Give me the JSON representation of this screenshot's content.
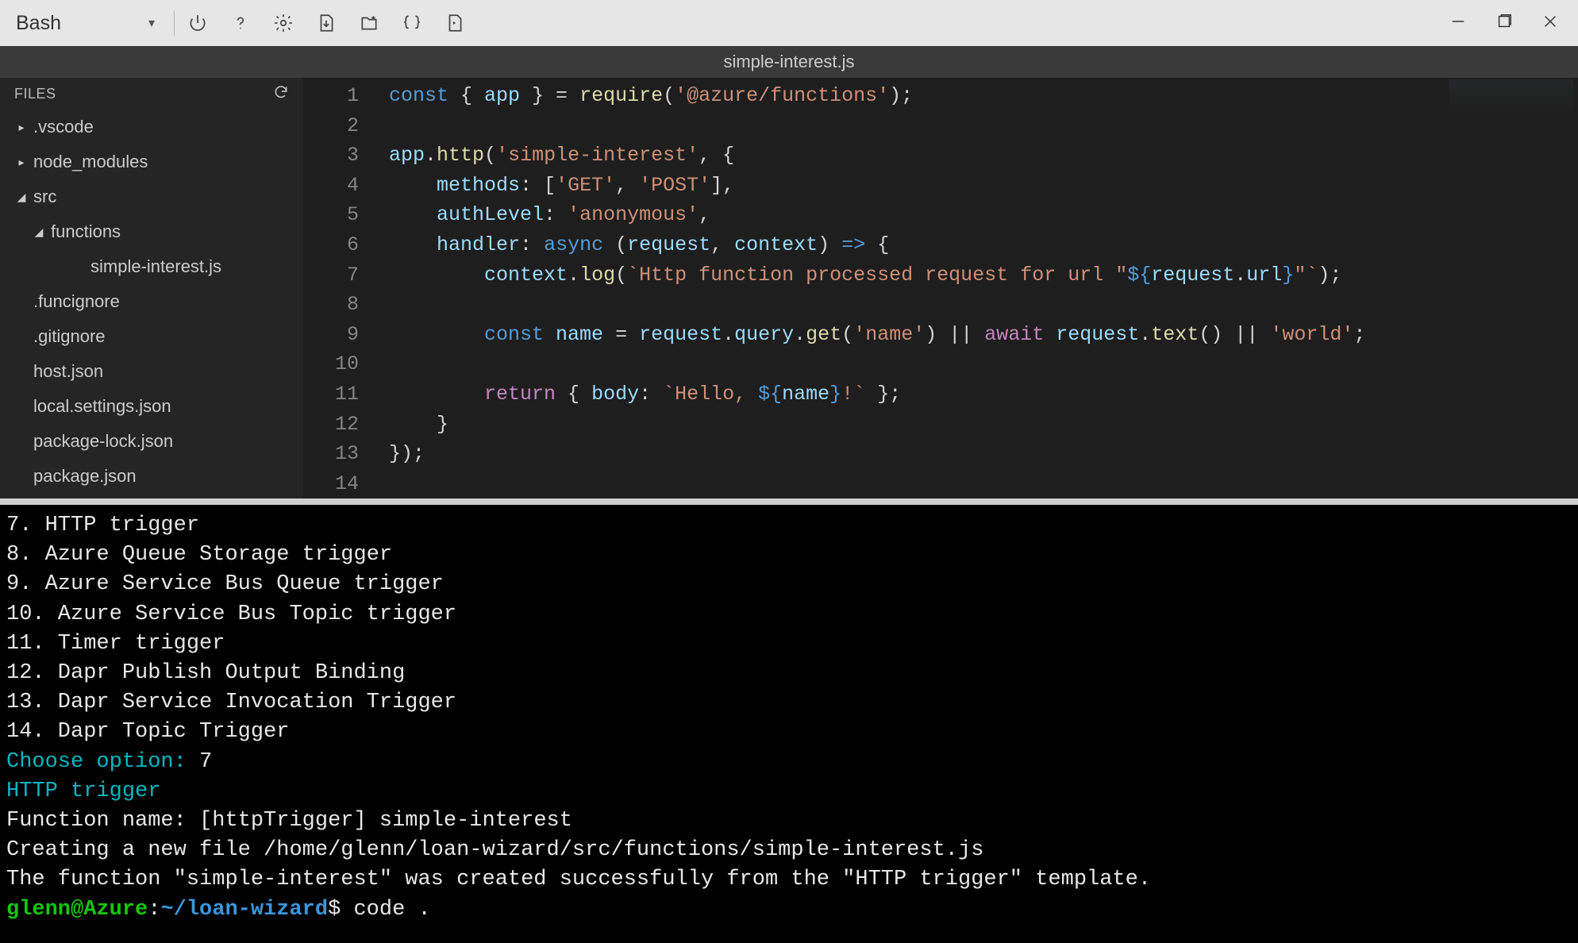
{
  "toolbar": {
    "shell_label": "Bash",
    "icons": [
      "power-icon",
      "help-icon",
      "settings-icon",
      "download-icon",
      "upload-icon",
      "braces-icon",
      "preview-icon"
    ]
  },
  "tab": {
    "filename": "simple-interest.js"
  },
  "sidebar": {
    "header": "FILES",
    "items": [
      {
        "label": ".vscode",
        "twisty": "▸",
        "indent": 0
      },
      {
        "label": "node_modules",
        "twisty": "▸",
        "indent": 0
      },
      {
        "label": "src",
        "twisty": "◢",
        "indent": 0
      },
      {
        "label": "functions",
        "twisty": "◢",
        "indent": 1
      },
      {
        "label": "simple-interest.js",
        "twisty": "",
        "indent": 3
      },
      {
        "label": ".funcignore",
        "twisty": "",
        "indent": 0
      },
      {
        "label": ".gitignore",
        "twisty": "",
        "indent": 0
      },
      {
        "label": "host.json",
        "twisty": "",
        "indent": 0
      },
      {
        "label": "local.settings.json",
        "twisty": "",
        "indent": 0
      },
      {
        "label": "package-lock.json",
        "twisty": "",
        "indent": 0
      },
      {
        "label": "package.json",
        "twisty": "",
        "indent": 0
      }
    ]
  },
  "editor": {
    "line_count": 14,
    "lines": [
      [
        {
          "t": "const ",
          "c": "kw-const"
        },
        {
          "t": "{ ",
          "c": "pun"
        },
        {
          "t": "app",
          "c": "obj"
        },
        {
          "t": " } = ",
          "c": "pun"
        },
        {
          "t": "require",
          "c": "fn"
        },
        {
          "t": "(",
          "c": "pun"
        },
        {
          "t": "'@azure/functions'",
          "c": "str"
        },
        {
          "t": ");",
          "c": "pun"
        }
      ],
      [],
      [
        {
          "t": "app",
          "c": "obj"
        },
        {
          "t": ".",
          "c": "pun"
        },
        {
          "t": "http",
          "c": "fn"
        },
        {
          "t": "(",
          "c": "pun"
        },
        {
          "t": "'simple-interest'",
          "c": "str"
        },
        {
          "t": ", {",
          "c": "pun"
        }
      ],
      [
        {
          "t": "    ",
          "c": "pun"
        },
        {
          "t": "methods",
          "c": "obj"
        },
        {
          "t": ": [",
          "c": "pun"
        },
        {
          "t": "'GET'",
          "c": "str"
        },
        {
          "t": ", ",
          "c": "pun"
        },
        {
          "t": "'POST'",
          "c": "str"
        },
        {
          "t": "],",
          "c": "pun"
        }
      ],
      [
        {
          "t": "    ",
          "c": "pun"
        },
        {
          "t": "authLevel",
          "c": "obj"
        },
        {
          "t": ": ",
          "c": "pun"
        },
        {
          "t": "'anonymous'",
          "c": "str"
        },
        {
          "t": ",",
          "c": "pun"
        }
      ],
      [
        {
          "t": "    ",
          "c": "pun"
        },
        {
          "t": "handler",
          "c": "obj"
        },
        {
          "t": ": ",
          "c": "pun"
        },
        {
          "t": "async ",
          "c": "kw-async"
        },
        {
          "t": "(",
          "c": "pun"
        },
        {
          "t": "request",
          "c": "obj"
        },
        {
          "t": ", ",
          "c": "pun"
        },
        {
          "t": "context",
          "c": "obj"
        },
        {
          "t": ") ",
          "c": "pun"
        },
        {
          "t": "=>",
          "c": "kw-const"
        },
        {
          "t": " {",
          "c": "pun"
        }
      ],
      [
        {
          "t": "        ",
          "c": "pun"
        },
        {
          "t": "context",
          "c": "obj"
        },
        {
          "t": ".",
          "c": "pun"
        },
        {
          "t": "log",
          "c": "fn"
        },
        {
          "t": "(",
          "c": "pun"
        },
        {
          "t": "`Http function processed request for url \"",
          "c": "tpl"
        },
        {
          "t": "${",
          "c": "bri"
        },
        {
          "t": "request",
          "c": "obj"
        },
        {
          "t": ".",
          "c": "pun"
        },
        {
          "t": "url",
          "c": "obj"
        },
        {
          "t": "}",
          "c": "bri"
        },
        {
          "t": "\"`",
          "c": "tpl"
        },
        {
          "t": ");",
          "c": "pun"
        }
      ],
      [],
      [
        {
          "t": "        ",
          "c": "pun"
        },
        {
          "t": "const ",
          "c": "kw-const"
        },
        {
          "t": "name",
          "c": "obj"
        },
        {
          "t": " = ",
          "c": "pun"
        },
        {
          "t": "request",
          "c": "obj"
        },
        {
          "t": ".",
          "c": "pun"
        },
        {
          "t": "query",
          "c": "obj"
        },
        {
          "t": ".",
          "c": "pun"
        },
        {
          "t": "get",
          "c": "fn"
        },
        {
          "t": "(",
          "c": "pun"
        },
        {
          "t": "'name'",
          "c": "str"
        },
        {
          "t": ") || ",
          "c": "pun"
        },
        {
          "t": "await ",
          "c": "kw-await"
        },
        {
          "t": "request",
          "c": "obj"
        },
        {
          "t": ".",
          "c": "pun"
        },
        {
          "t": "text",
          "c": "fn"
        },
        {
          "t": "() || ",
          "c": "pun"
        },
        {
          "t": "'world'",
          "c": "str"
        },
        {
          "t": ";",
          "c": "pun"
        }
      ],
      [],
      [
        {
          "t": "        ",
          "c": "pun"
        },
        {
          "t": "return",
          "c": "kw-ret"
        },
        {
          "t": " { ",
          "c": "pun"
        },
        {
          "t": "body",
          "c": "obj"
        },
        {
          "t": ": ",
          "c": "pun"
        },
        {
          "t": "`Hello, ",
          "c": "tpl"
        },
        {
          "t": "${",
          "c": "bri"
        },
        {
          "t": "name",
          "c": "obj"
        },
        {
          "t": "}",
          "c": "bri"
        },
        {
          "t": "!`",
          "c": "tpl"
        },
        {
          "t": " };",
          "c": "pun"
        }
      ],
      [
        {
          "t": "    }",
          "c": "pun"
        }
      ],
      [
        {
          "t": "});",
          "c": "pun"
        }
      ],
      []
    ]
  },
  "terminal": {
    "lines": [
      [
        {
          "t": "7. HTTP trigger",
          "c": "t-white"
        }
      ],
      [
        {
          "t": "8. Azure Queue Storage trigger",
          "c": "t-white"
        }
      ],
      [
        {
          "t": "9. Azure Service Bus Queue trigger",
          "c": "t-white"
        }
      ],
      [
        {
          "t": "10. Azure Service Bus Topic trigger",
          "c": "t-white"
        }
      ],
      [
        {
          "t": "11. Timer trigger",
          "c": "t-white"
        }
      ],
      [
        {
          "t": "12. Dapr Publish Output Binding",
          "c": "t-white"
        }
      ],
      [
        {
          "t": "13. Dapr Service Invocation Trigger",
          "c": "t-white"
        }
      ],
      [
        {
          "t": "14. Dapr Topic Trigger",
          "c": "t-white"
        }
      ],
      [
        {
          "t": "Choose option: ",
          "c": "t-cyan"
        },
        {
          "t": "7",
          "c": "t-white"
        }
      ],
      [
        {
          "t": "HTTP trigger",
          "c": "t-cyan"
        }
      ],
      [
        {
          "t": "Function name: [httpTrigger] ",
          "c": "t-white"
        },
        {
          "t": "simple-interest",
          "c": "t-white"
        }
      ],
      [
        {
          "t": "Creating a new file /home/glenn/loan-wizard/src/functions/simple-interest.js",
          "c": "t-white"
        }
      ],
      [
        {
          "t": "The function \"simple-interest\" was created successfully from the \"HTTP trigger\" template.",
          "c": "t-white"
        }
      ],
      [
        {
          "t": "glenn@Azure",
          "c": "t-green"
        },
        {
          "t": ":",
          "c": "t-white"
        },
        {
          "t": "~/loan-wizard",
          "c": "t-blue"
        },
        {
          "t": "$ code .",
          "c": "t-white"
        }
      ]
    ]
  }
}
